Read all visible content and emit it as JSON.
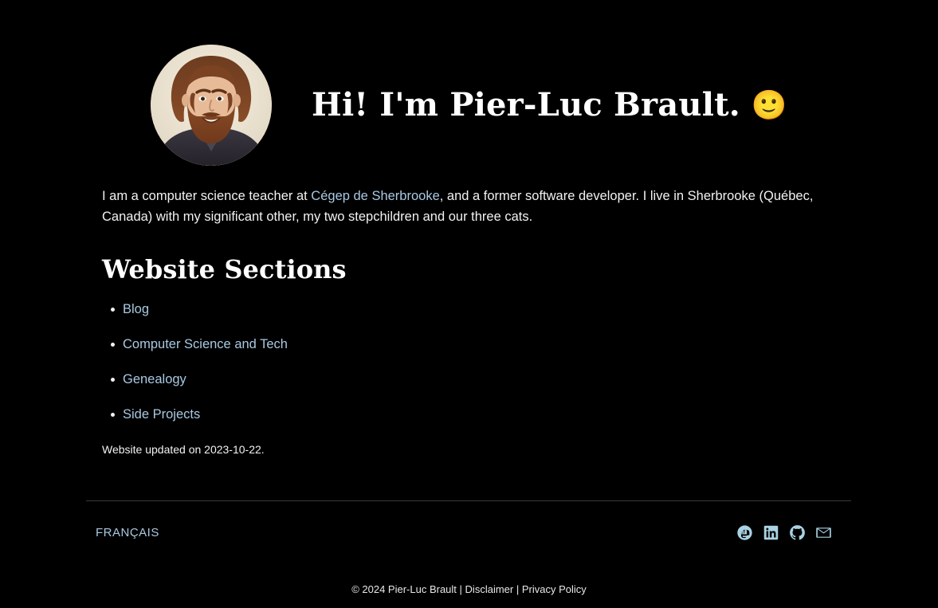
{
  "theme": {
    "background": "#000000",
    "text_color": "#f2f2f2",
    "link_color": "#a9c9e2",
    "icon_color": "#a9d2e2",
    "divider_color": "#3a3a3a"
  },
  "hero": {
    "avatar_alt": "Portrait photo of Pier-Luc Brault",
    "title": "Hi! I'm Pier-Luc Brault.",
    "emoji": "🙂"
  },
  "intro": {
    "part1": "I am a computer science teacher at ",
    "link": "Cégep de Sherbrooke",
    "part2": ", and a former software developer. I live in Sherbrooke (Québec, Canada) with my significant other, my two stepchildren and our three cats."
  },
  "sections": {
    "heading": "Website Sections",
    "items": [
      {
        "label": "Blog"
      },
      {
        "label": "Computer Science and Tech"
      },
      {
        "label": "Genealogy"
      },
      {
        "label": "Side Projects"
      }
    ]
  },
  "updated": {
    "text": "Website updated on 2023-10-22."
  },
  "footer": {
    "language_link": "FRANÇAIS",
    "social": [
      {
        "name": "mastodon-icon",
        "label": "Mastodon"
      },
      {
        "name": "linkedin-icon",
        "label": "LinkedIn"
      },
      {
        "name": "github-icon",
        "label": "GitHub"
      },
      {
        "name": "email-icon",
        "label": "Email"
      }
    ],
    "copyright": "© 2024 Pier-Luc Brault",
    "separator1": "|",
    "disclaimer": "Disclaimer",
    "separator2": "|",
    "privacy": "Privacy Policy"
  }
}
